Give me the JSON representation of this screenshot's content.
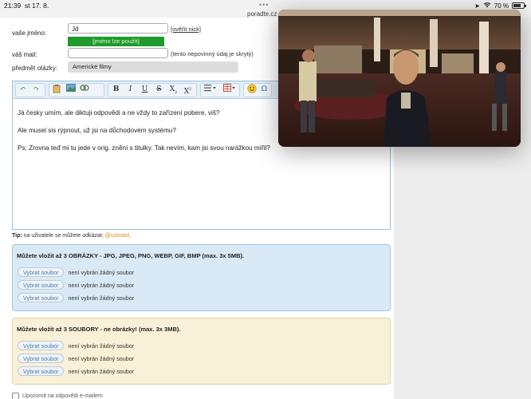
{
  "status_bar": {
    "time": "21:39",
    "date": "st 17. 8.",
    "url": "poradte.cz",
    "battery_text": "70 %"
  },
  "form": {
    "name_label": "vaše jméno:",
    "name_value": "Jd",
    "verify_link": "[ověřit nick]",
    "name_used_msg": "[jméno lze použít]",
    "mail_label": "váš mail:",
    "mail_value": "",
    "mail_note": "(tento nepovinný údaj je skrytý)",
    "subject_label": "předmět otázky:",
    "subject_value": "Americké filmy"
  },
  "editor": {
    "toolbar_icons": [
      "undo-icon",
      "redo-icon",
      "paste-text-icon",
      "image-icon",
      "link-icon",
      "bold-icon",
      "italic-icon",
      "underline-icon",
      "strikethrough-icon",
      "subscript-icon",
      "superscript-icon",
      "list-icon",
      "table-icon",
      "emoji-icon",
      "special-char-icon"
    ],
    "paragraphs": [
      "Já česky umím, ale diktuji odpovědi a ne vždy to zařízení pobere, viš?",
      "Ale musel sis rýpnout, už jsi na důchodovém systému?",
      "Ps: Zrovna teď mi tu jede v orig. znění s titulky. Tak nevím, kam jsi svou narážkou mířil?"
    ]
  },
  "tip": {
    "label": "Tip:",
    "text": "na uživatele se můžete odkázat:",
    "mention": "@uzivatel"
  },
  "images_box": {
    "title": "Můžete vložit až 3 OBRÁZKY - JPG, JPEG, PNG, WEBP, GIF, BMP (max. 3x 5MB).",
    "rows": [
      {
        "button": "Vybrat soubor",
        "status": "není vybrán žádný soubor"
      },
      {
        "button": "Vybrat soubor",
        "status": "není vybrán žádný soubor"
      },
      {
        "button": "Vybrat soubor",
        "status": "není vybrán žádný soubor"
      }
    ]
  },
  "files_box": {
    "title": "Můžete vložit až 3 SOUBORY - ne obrázky! (max. 3x 3MB).",
    "rows": [
      {
        "button": "Vybrat soubor",
        "status": "není vybrán žádný soubor"
      },
      {
        "button": "Vybrat soubor",
        "status": "není vybrán žádný soubor"
      },
      {
        "button": "Vybrat soubor",
        "status": "není vybrán žádný soubor"
      }
    ]
  },
  "footer": {
    "checkbox_label": "Upozornit na odpovědi e-mailem"
  },
  "colors": {
    "accent_green": "#1e9b2a",
    "blue_box": "#d9e9f6",
    "yellow_box": "#f8f1d7",
    "mention": "#e08a1e"
  }
}
